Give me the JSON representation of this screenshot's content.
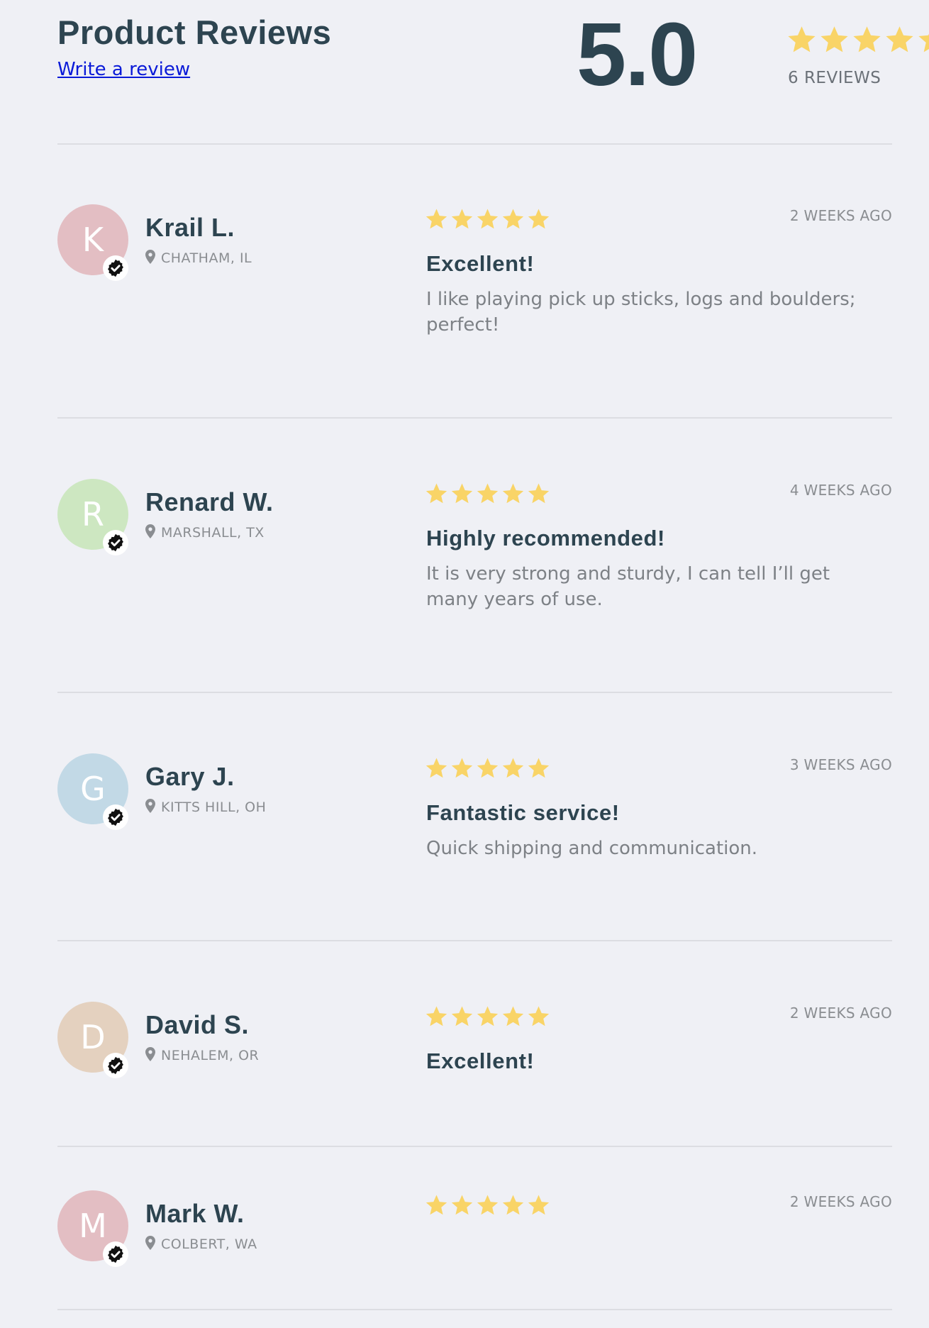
{
  "header": {
    "title": "Product Reviews",
    "write_review_label": "Write a review",
    "average_score": "5.0",
    "average_stars": 5,
    "review_count_label": "6 REVIEWS"
  },
  "colors": {
    "background": "#eff0f5",
    "heading": "#2d4450",
    "link": "#0a1ad8",
    "star": "#f9d467",
    "muted": "#8a8d91",
    "verified_badge": "#111111"
  },
  "reviews": [
    {
      "initial": "K",
      "avatar_color": "#e3bec3",
      "name": "Krail L.",
      "location": "CHATHAM, IL",
      "rating": 5,
      "date": "2 WEEKS AGO",
      "title": "Excellent!",
      "body": "I like playing pick up sticks, logs and boulders; perfect!"
    },
    {
      "initial": "R",
      "avatar_color": "#cde7c1",
      "name": "Renard W.",
      "location": "MARSHALL, TX",
      "rating": 5,
      "date": "4 WEEKS AGO",
      "title": "Highly recommended!",
      "body": "It is very strong and sturdy, I can tell I’ll get many years of use."
    },
    {
      "initial": "G",
      "avatar_color": "#c2d9e6",
      "name": "Gary J.",
      "location": "KITTS HILL, OH",
      "rating": 5,
      "date": "3 WEEKS AGO",
      "title": "Fantastic service!",
      "body": "Quick shipping and communication."
    },
    {
      "initial": "D",
      "avatar_color": "#e4d1bf",
      "name": "David S.",
      "location": "NEHALEM, OR",
      "rating": 5,
      "date": "2 WEEKS AGO",
      "title": "Excellent!",
      "body": ""
    },
    {
      "initial": "M",
      "avatar_color": "#e3bec3",
      "name": "Mark W.",
      "location": "COLBERT, WA",
      "rating": 5,
      "date": "2 WEEKS AGO",
      "title": "",
      "body": ""
    }
  ]
}
